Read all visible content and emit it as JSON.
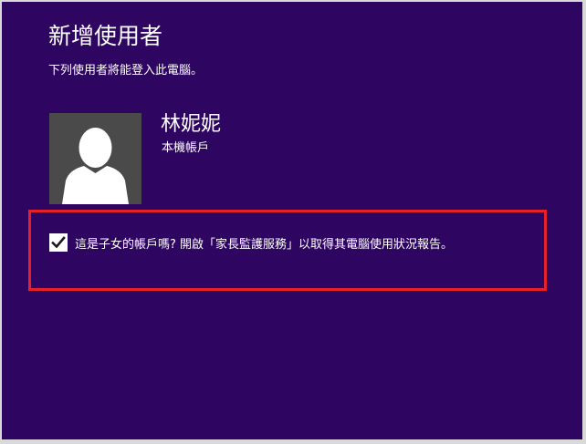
{
  "page": {
    "title": "新增使用者",
    "subtitle": "下列使用者將能登入此電腦。"
  },
  "user": {
    "name": "林妮妮",
    "account_type": "本機帳戶",
    "avatar_icon": "user-silhouette-icon"
  },
  "family_safety": {
    "checked": true,
    "label": "這是子女的帳戶嗎? 開啟「家長監護服務」以取得其電腦使用狀況報告。",
    "check_icon": "checkmark-icon"
  },
  "colors": {
    "background": "#2e0561",
    "avatar_background": "#4a4a4a",
    "highlight_border": "#e8202a",
    "text": "#ffffff"
  }
}
